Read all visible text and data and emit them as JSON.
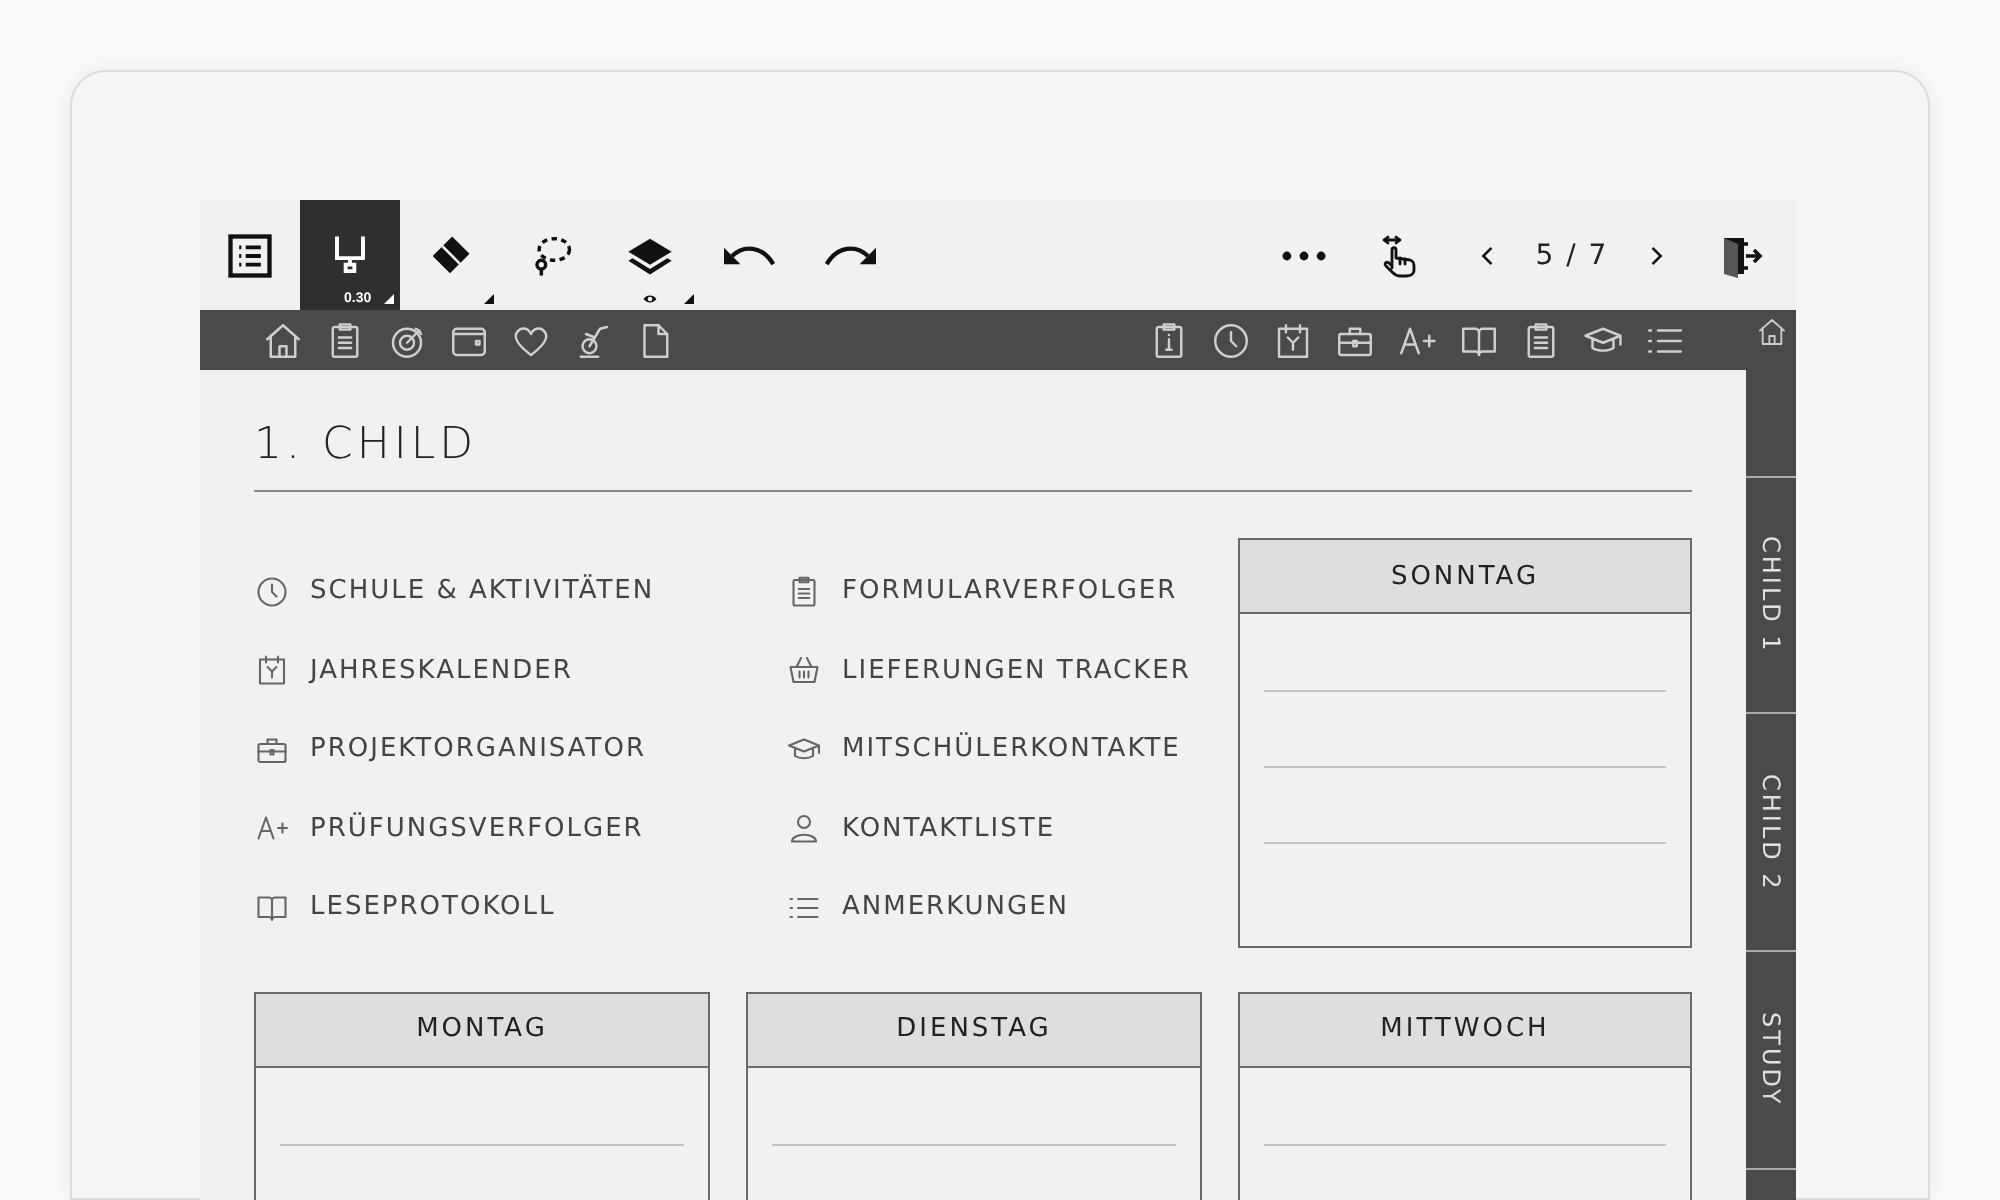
{
  "toolbar": {
    "tools": [
      {
        "kind": "menu",
        "selected": false,
        "expandable": false
      },
      {
        "kind": "pen",
        "selected": true,
        "expandable": true,
        "size": "0.30"
      },
      {
        "kind": "eraser",
        "selected": false,
        "expandable": true
      },
      {
        "kind": "lasso",
        "selected": false,
        "expandable": false
      },
      {
        "kind": "layers",
        "selected": false,
        "expandable": true
      },
      {
        "kind": "undo",
        "selected": false,
        "expandable": false
      },
      {
        "kind": "redo",
        "selected": false,
        "expandable": false
      }
    ],
    "page": "5 / 7"
  },
  "nav_bar": {
    "left_icons": [
      {
        "kind": "home"
      },
      {
        "kind": "clipboard"
      },
      {
        "kind": "target"
      },
      {
        "kind": "wallet"
      },
      {
        "kind": "heart"
      },
      {
        "kind": "bike"
      },
      {
        "kind": "document"
      }
    ],
    "right_icons": [
      {
        "kind": "info"
      },
      {
        "kind": "clock"
      },
      {
        "kind": "calendar"
      },
      {
        "kind": "briefcase"
      },
      {
        "kind": "grade"
      },
      {
        "kind": "book"
      },
      {
        "kind": "clipboard"
      },
      {
        "kind": "cap"
      },
      {
        "kind": "list"
      }
    ]
  },
  "title": "1. CHILD",
  "links": [
    [
      {
        "kind": "clock",
        "label": "SCHULE & AKTIVITÄTEN"
      },
      {
        "kind": "calendar",
        "label": "JAHRESKALENDER"
      },
      {
        "kind": "briefcase",
        "label": "PROJEKTORGANISATOR"
      },
      {
        "kind": "grade",
        "label": "PRÜFUNGSVERFOLGER"
      },
      {
        "kind": "book",
        "label": "LESEPROTOKOLL"
      }
    ],
    [
      {
        "kind": "clipboard",
        "label": "FORMULARVERFOLGER"
      },
      {
        "kind": "basket",
        "label": "LIEFERUNGEN TRACKER"
      },
      {
        "kind": "cap",
        "label": "MITSCHÜLERKONTAKTE"
      },
      {
        "kind": "person",
        "label": "KONTAKTLISTE"
      },
      {
        "kind": "list",
        "label": "ANMERKUNGEN"
      }
    ]
  ],
  "day_boxes": [
    {
      "label": "SONNTAG"
    },
    {
      "label": "MONTAG"
    },
    {
      "label": "DIENSTAG"
    },
    {
      "label": "MITTWOCH"
    }
  ],
  "side_tabs": [
    {
      "kind": "home"
    },
    {
      "kind": "text",
      "label": "CHILD 1"
    },
    {
      "kind": "text",
      "label": "CHILD 2"
    },
    {
      "kind": "text",
      "label": "STUDY"
    }
  ]
}
